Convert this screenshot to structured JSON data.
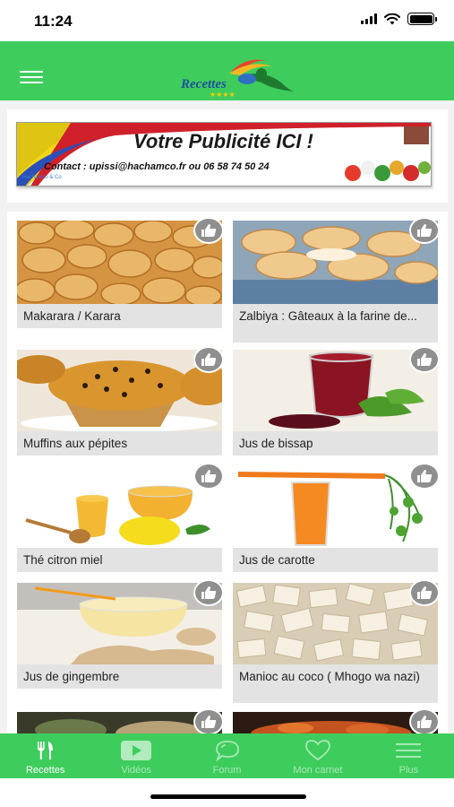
{
  "status_bar": {
    "time": "11:24"
  },
  "header": {
    "logo_text": "Recettes",
    "menu_icon": "hamburger-icon"
  },
  "ad": {
    "title": "Votre Publicité ICI !",
    "contact": "Contact : upissi@hachamco.fr  ou  06 58 74 50 24",
    "brand": "Hachamco & Co"
  },
  "recipes": [
    {
      "label": "Makarara / Karara"
    },
    {
      "label": "Zalbiya : Gâteaux à la farine de..."
    },
    {
      "label": "Muffins aux pépites"
    },
    {
      "label": "Jus de bissap"
    },
    {
      "label": "Thé citron miel"
    },
    {
      "label": "Jus de carotte"
    },
    {
      "label": "Jus de gingembre"
    },
    {
      "label": "Manioc au coco ( Mhogo wa nazi)"
    }
  ],
  "tabs": [
    {
      "label": "Recettes",
      "icon": "fork-knife-icon",
      "active": true
    },
    {
      "label": "Vidéos",
      "icon": "play-video-icon",
      "active": false
    },
    {
      "label": "Forum",
      "icon": "chat-bubble-icon",
      "active": false
    },
    {
      "label": "Mon carnet",
      "icon": "heart-icon",
      "active": false
    },
    {
      "label": "Plus",
      "icon": "more-menu-icon",
      "active": false
    }
  ],
  "colors": {
    "brand_green": "#3ecd5d",
    "label_bg": "#e3e3e3",
    "like_bg": "#8f8f8f"
  }
}
